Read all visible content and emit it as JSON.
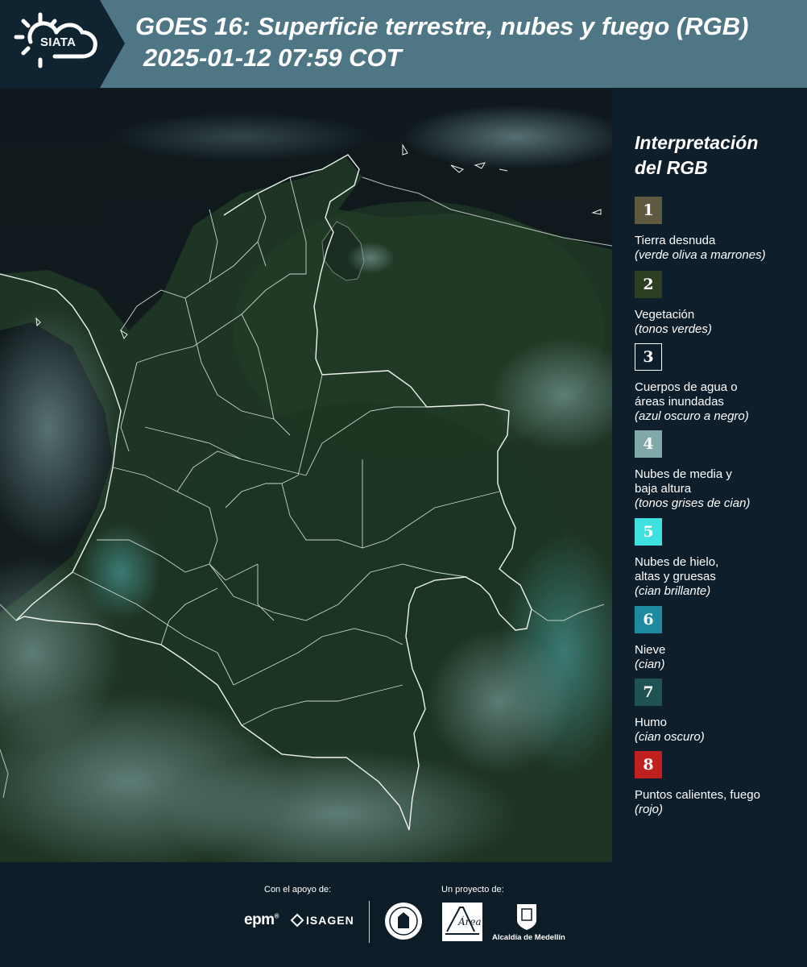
{
  "header": {
    "logo_text": "SIATA",
    "title": "GOES 16: Superficie terrestre, nubes y fuego (RGB)",
    "subtitle": "2025-01-12 07:59 COT"
  },
  "legend": {
    "title_line1": "Interpretación",
    "title_line2": "del RGB",
    "items": [
      {
        "number": "1",
        "color": "#5f5a3f",
        "label_lines": [
          "Tierra desnuda"
        ],
        "description": "(verde oliva a marrones)"
      },
      {
        "number": "2",
        "color": "#2e3e22",
        "label_lines": [
          "Vegetación"
        ],
        "description": "(tonos verdes)"
      },
      {
        "number": "3",
        "color": "#0e1e2a",
        "label_lines": [
          "Cuerpos de agua o",
          "áreas inundadas"
        ],
        "description": "(azul oscuro a negro)"
      },
      {
        "number": "4",
        "color": "#80a8a8",
        "label_lines": [
          "Nubes de media y",
          "baja altura"
        ],
        "description": "(tonos grises de cian)"
      },
      {
        "number": "5",
        "color": "#3ee0e0",
        "label_lines": [
          "Nubes de hielo,",
          "altas y gruesas"
        ],
        "description": "(cian brillante)"
      },
      {
        "number": "6",
        "color": "#1e8aa0",
        "label_lines": [
          "Nieve"
        ],
        "description": "(cian)"
      },
      {
        "number": "7",
        "color": "#1f5352",
        "label_lines": [
          "Humo"
        ],
        "description": "(cian oscuro)"
      },
      {
        "number": "8",
        "color": "#c0211f",
        "label_lines": [
          "Puntos calientes, fuego"
        ],
        "description": "(rojo)"
      }
    ]
  },
  "footer": {
    "support_label": "Con el apoyo de:",
    "project_label": "Un proyecto de:",
    "epm_logo": "epm",
    "isagen_logo": "ISAGEN",
    "area_logo": "Área",
    "alcaldia_logo": "Alcaldía de Medellín"
  },
  "colors": {
    "header_bg": "#4f7685",
    "logo_bg": "#0f2330",
    "legend_bg": "#0e1e2a",
    "map_land": "#1f3524"
  }
}
